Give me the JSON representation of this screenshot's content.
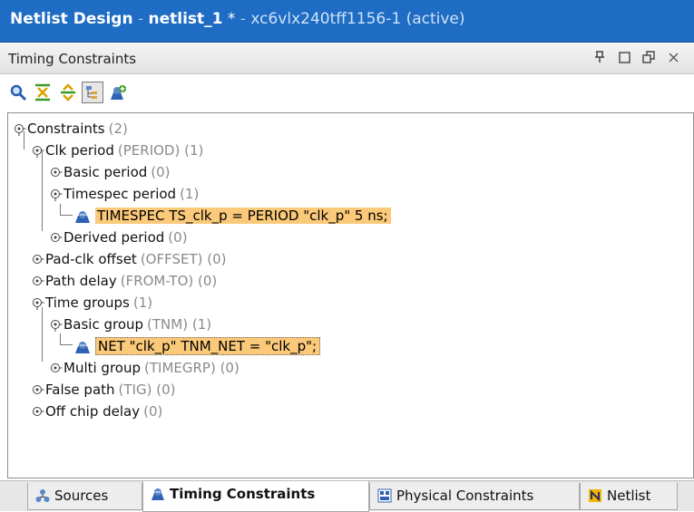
{
  "window": {
    "app_title": "Netlist Design",
    "separator": " - ",
    "design_name": "netlist_1",
    "modified": " *",
    "part_status": "xc6vlx240tff1156-1 (active)"
  },
  "panel": {
    "title": "Timing Constraints",
    "controls": [
      "pin-icon",
      "maximize-icon",
      "restore-icon",
      "close-icon"
    ]
  },
  "toolbar": {
    "icons": [
      "search-icon",
      "collapse-all-icon",
      "expand-all-icon",
      "tree-view-icon",
      "add-constraint-icon"
    ]
  },
  "tree": {
    "root": {
      "label": "Constraints",
      "count": "(2)"
    },
    "clk_period": {
      "label": "Clk period",
      "count": "(PERIOD) (1)"
    },
    "basic_period": {
      "label": "Basic period",
      "count": "(0)"
    },
    "timespec_period": {
      "label": "Timespec period",
      "count": "(1)"
    },
    "timespec_constraint": {
      "text": "TIMESPEC TS_clk_p = PERIOD \"clk_p\" 5 ns;"
    },
    "derived_period": {
      "label": "Derived period",
      "count": "(0)"
    },
    "pad_clk_offset": {
      "label": "Pad-clk offset",
      "count": "(OFFSET) (0)"
    },
    "path_delay": {
      "label": "Path delay",
      "count": "(FROM-TO) (0)"
    },
    "time_groups": {
      "label": "Time groups",
      "count": "(1)"
    },
    "basic_group": {
      "label": "Basic group",
      "count": "(TNM) (1)"
    },
    "net_constraint": {
      "text": "NET \"clk_p\" TNM_NET = \"clk_p\";"
    },
    "multi_group": {
      "label": "Multi group",
      "count": "(TIMEGRP) (0)"
    },
    "false_path": {
      "label": "False path",
      "count": "(TIG) (0)"
    },
    "off_chip_delay": {
      "label": "Off chip delay",
      "count": "(0)"
    }
  },
  "tabs": {
    "sources": "Sources",
    "timing_constraints": "Timing Constraints",
    "physical_constraints": "Physical Constraints",
    "netlist": "Netlist",
    "active": "Timing Constraints"
  },
  "colors": {
    "title_bar": "#1e6cc4",
    "highlight": "#fbc97a"
  }
}
